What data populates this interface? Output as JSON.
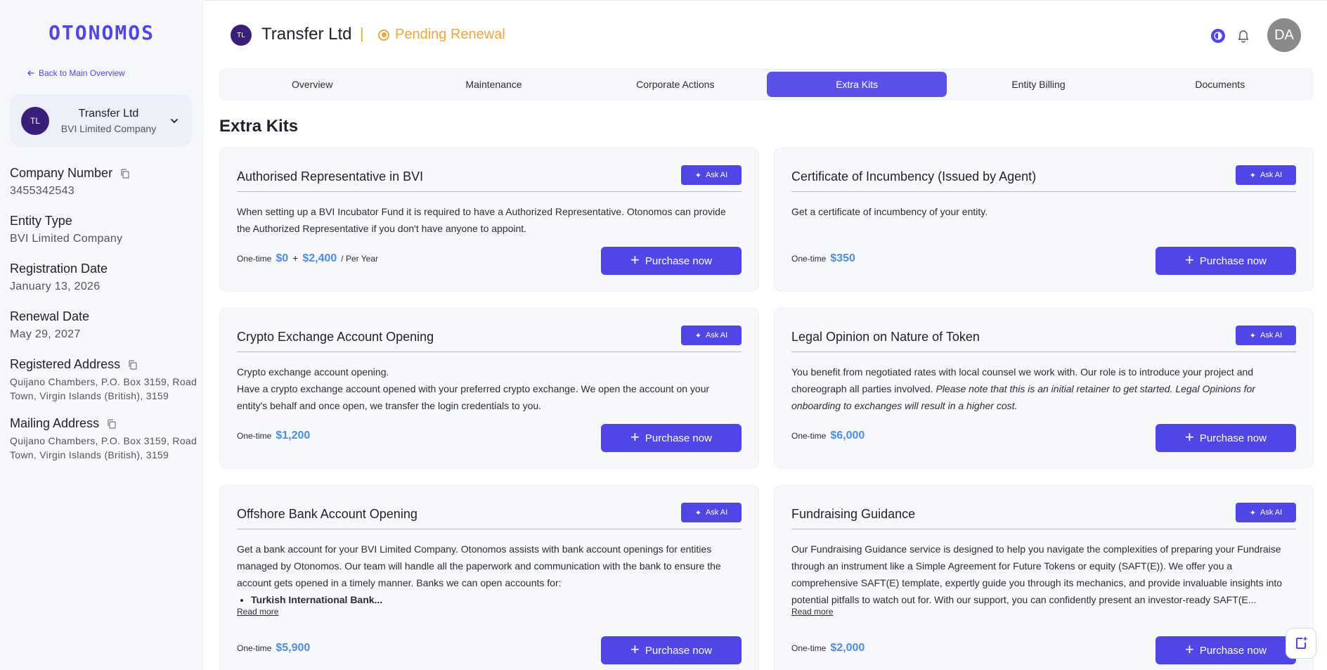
{
  "sidebar": {
    "logo": "OTONOMOS",
    "back_link": "Back to Main Overview",
    "entity": {
      "initials": "TL",
      "name": "Transfer Ltd",
      "type": "BVI Limited Company"
    },
    "fields": [
      {
        "label": "Company Number",
        "value": "3455342543"
      },
      {
        "label": "Entity Type",
        "value": "BVI Limited Company"
      },
      {
        "label": "Registration Date",
        "value": "January 13, 2026"
      },
      {
        "label": "Renewal Date",
        "value": "May 29, 2027"
      },
      {
        "label": "Registered Address",
        "value": "Quijano Chambers, P.O. Box 3159, Road Town, Virgin Islands (British), 3159"
      },
      {
        "label": "Mailing Address",
        "value": "Quijano Chambers, P.O. Box 3159, Road Town, Virgin Islands (British), 3159"
      }
    ]
  },
  "header": {
    "initials": "TL",
    "title": "Transfer Ltd",
    "separator": "|",
    "status": "Pending Renewal",
    "user_initials": "DA"
  },
  "tabs": [
    "Overview",
    "Maintenance",
    "Corporate Actions",
    "Extra Kits",
    "Entity Billing",
    "Documents"
  ],
  "active_tab": "Extra Kits",
  "section_title": "Extra Kits",
  "common": {
    "ask_ai": "Ask AI",
    "purchase": "Purchase  now",
    "one_time": "One-time",
    "read_more": "Read more",
    "plus": "+"
  },
  "cards": [
    {
      "title": "Authorised Representative in BVI",
      "desc": "When setting up a BVI Incubator Fund it is required to have a Authorized Representative. Otonomos can provide the Authorized Representative if you don't have anyone to appoint.",
      "price": "$0",
      "price2": "$2,400",
      "suffix": "/ Per Year"
    },
    {
      "title": "Certificate of Incumbency (Issued by Agent)",
      "desc": "Get a certificate of incumbency of your entity.",
      "price": "$350"
    },
    {
      "title": "Crypto Exchange Account Opening",
      "desc_line1": "Crypto exchange account opening.",
      "desc_line2": "Have a crypto exchange account opened with your preferred crypto exchange. We open the account on your entity's behalf and once open, we transfer the login credentials to you.",
      "price": "$1,200"
    },
    {
      "title": "Legal Opinion on Nature of Token",
      "desc": "You benefit from negotiated rates with local counsel we work with. Our role is to introduce your project and choreograph all parties involved.",
      "desc_italic": "Please note that this is an initial retainer to get started. Legal Opinions for onboarding to exchanges will result in a higher cost.",
      "price": "$6,000"
    },
    {
      "title": "Offshore Bank Account Opening",
      "desc": "Get a bank account for your BVI Limited Company. Otonomos assists with bank account openings for entities managed by Otonomos. Our team will handle all the paperwork and communication with the bank to ensure the account gets opened in a timely manner. Banks we can open accounts for:",
      "bullet": "Turkish International Bank...",
      "price": "$5,900"
    },
    {
      "title": "Fundraising Guidance",
      "desc": "Our Fundraising Guidance service is designed to help you navigate the complexities of preparing your Fundraise through an instrument like a Simple Agreement for Future Tokens or equity (SAFT(E)). We offer you a comprehensive SAFT(E) template, expertly guide you through its mechanics, and provide invaluable insights into potential pitfalls to watch out for. With our support, you can confidently present an investor-ready SAFT(E...",
      "price": "$2,000"
    }
  ],
  "colors": {
    "brand": "#5046e5",
    "status_pending": "#f0a640",
    "price": "#4d8de5"
  }
}
